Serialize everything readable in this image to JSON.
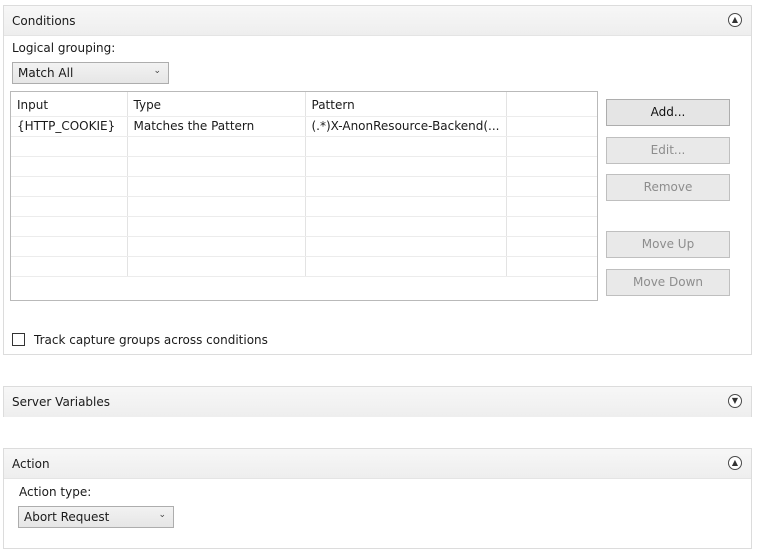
{
  "conditions": {
    "title": "Conditions",
    "logical_grouping_label": "Logical grouping:",
    "logical_grouping_value": "Match All",
    "table": {
      "columns": [
        "Input",
        "Type",
        "Pattern",
        ""
      ],
      "rows": [
        [
          "{HTTP_COOKIE}",
          "Matches the Pattern",
          "(.*)X-AnonResource-Backend(...",
          ""
        ],
        [
          "",
          "",
          "",
          ""
        ],
        [
          "",
          "",
          "",
          ""
        ],
        [
          "",
          "",
          "",
          ""
        ],
        [
          "",
          "",
          "",
          ""
        ],
        [
          "",
          "",
          "",
          ""
        ],
        [
          "",
          "",
          "",
          ""
        ],
        [
          "",
          "",
          "",
          ""
        ]
      ]
    },
    "buttons": {
      "add": "Add...",
      "edit": "Edit...",
      "remove": "Remove",
      "move_up": "Move Up",
      "move_down": "Move Down"
    },
    "track_capture_label": "Track capture groups across conditions",
    "track_capture_checked": false
  },
  "server_variables": {
    "title": "Server Variables"
  },
  "action": {
    "title": "Action",
    "action_type_label": "Action type:",
    "action_type_value": "Abort Request"
  },
  "icons": {
    "collapse": "chevron-up-icon",
    "expand": "chevron-down-icon",
    "dropdown": "chevron-down-icon"
  }
}
